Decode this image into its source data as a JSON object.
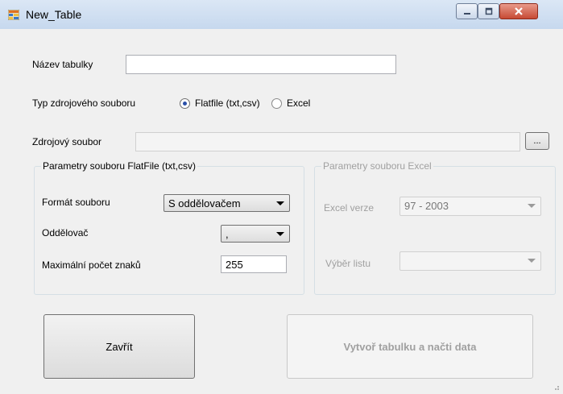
{
  "window": {
    "title": "New_Table",
    "controls": [
      "minimize-icon",
      "maximize-icon",
      "close-icon"
    ]
  },
  "form": {
    "table_name": {
      "label": "Název tabulky",
      "value": ""
    },
    "source_type": {
      "label": "Typ zdrojového souboru",
      "options": [
        {
          "label": "Flatfile (txt,csv)",
          "selected": true
        },
        {
          "label": "Excel",
          "selected": false
        }
      ]
    },
    "source_file": {
      "label": "Zdrojový soubor",
      "value": "",
      "browse_label": "..."
    }
  },
  "flatfile_group": {
    "title": "Parametry souboru FlatFile (txt,csv)",
    "format": {
      "label": "Formát souboru",
      "value": "S oddělovačem"
    },
    "delimiter": {
      "label": "Oddělovač",
      "value": ","
    },
    "max_chars": {
      "label": "Maximální počet znaků",
      "value": "255"
    }
  },
  "excel_group": {
    "title": "Parametry souboru Excel",
    "version": {
      "label": "Excel verze",
      "value": "97 - 2003"
    },
    "sheet": {
      "label": "Výběr listu",
      "value": ""
    }
  },
  "buttons": {
    "close": "Zavřít",
    "create": "Vytvoř tabulku a načti data"
  },
  "colors": {
    "radio_selected": "#2a4fa8",
    "close_button": "#c64a34"
  }
}
